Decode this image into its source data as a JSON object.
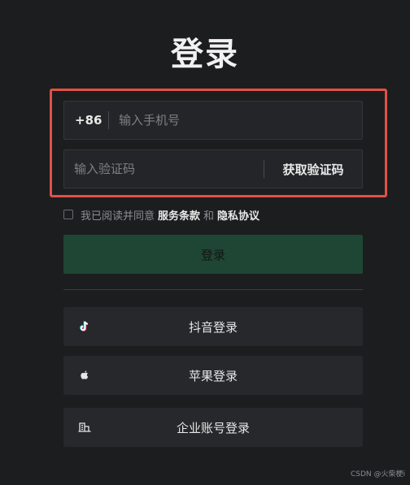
{
  "page": {
    "title": "登录"
  },
  "phone": {
    "country_code": "+86",
    "placeholder": "输入手机号",
    "value": ""
  },
  "code": {
    "placeholder": "输入验证码",
    "value": "",
    "get_code_label": "获取验证码"
  },
  "agreement": {
    "checked": false,
    "prefix": "我已阅读并同意",
    "terms_label": "服务条款",
    "and": "和",
    "privacy_label": "隐私协议"
  },
  "login_button": {
    "label": "登录"
  },
  "alt_logins": [
    {
      "label": "抖音登录",
      "icon": "tiktok-icon"
    },
    {
      "label": "苹果登录",
      "icon": "apple-icon"
    },
    {
      "label": "企业账号登录",
      "icon": "enterprise-icon"
    }
  ],
  "colors": {
    "background": "#1c1d1f",
    "highlight": "#e05245",
    "login_button_bg": "#1f4634"
  },
  "watermark": "CSDN @火柴梗i"
}
